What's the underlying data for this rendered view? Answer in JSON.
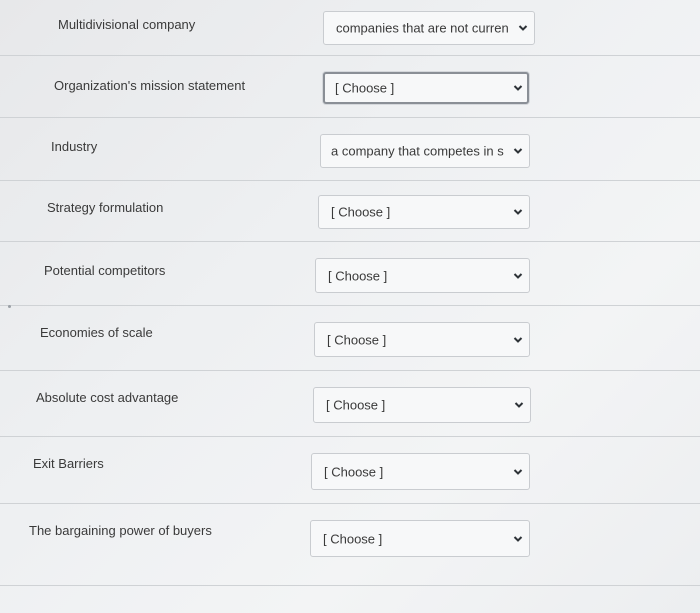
{
  "rows": [
    {
      "term": "Multidivisional company",
      "selected": "companies that are not curren"
    },
    {
      "term": "Organization's mission statement",
      "selected": "[ Choose ]"
    },
    {
      "term": "Industry",
      "selected": "a company that competes in s"
    },
    {
      "term": "Strategy formulation",
      "selected": "[ Choose ]"
    },
    {
      "term": "Potential competitors",
      "selected": "[ Choose ]"
    },
    {
      "term": "Economies of scale",
      "selected": "[ Choose ]"
    },
    {
      "term": "Absolute cost advantage",
      "selected": "[ Choose ]"
    },
    {
      "term": "Exit Barriers",
      "selected": "[ Choose ]"
    },
    {
      "term": "The bargaining power of buyers",
      "selected": "[ Choose ]"
    }
  ],
  "icons": {
    "dropdown": "chevron-down-icon"
  }
}
